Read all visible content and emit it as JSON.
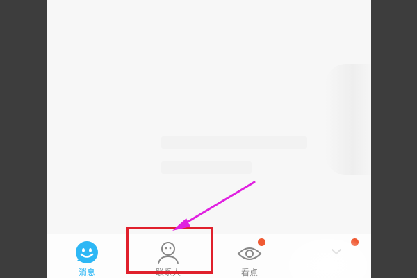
{
  "tab_bar": {
    "tabs": [
      {
        "label": "消息",
        "icon": "smiley-chat-icon",
        "active": true
      },
      {
        "label": "联系人",
        "icon": "contact-person-icon",
        "active": false
      },
      {
        "label": "看点",
        "icon": "eye-icon",
        "active": false,
        "badge": true
      },
      {
        "label": "",
        "icon": "more-icon",
        "active": false,
        "badge": true
      }
    ]
  },
  "colors": {
    "accent": "#2db7f5",
    "badge": "#f05a33",
    "highlight": "#e0202c",
    "arrow": "#e020e0",
    "inactive_text": "#888888"
  }
}
